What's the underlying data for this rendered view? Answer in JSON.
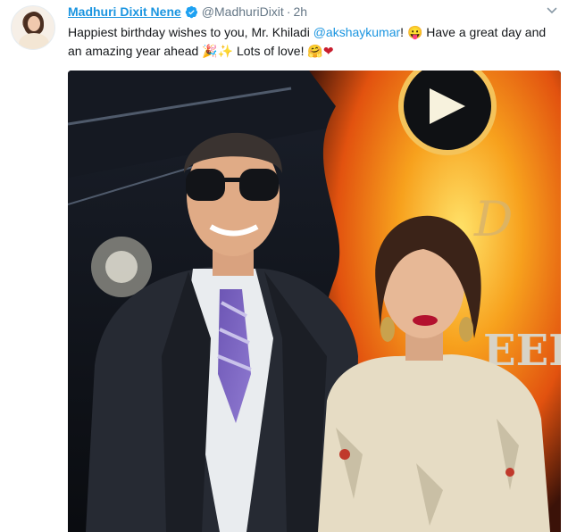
{
  "tweet": {
    "display_name": "Madhuri Dixit Nene",
    "handle": "@MadhuriDixit",
    "separator": "·",
    "time": "2h",
    "text_part1": "Happiest birthday wishes to you, Mr. Khiladi ",
    "mention": "@akshaykumar",
    "text_part2": "! ",
    "emoji_tongue": "😛",
    "text_part3": " Have a great day and an amazing year ahead ",
    "emoji_party": "🎉",
    "emoji_sparkles": "✨",
    "text_part4": " Lots of love! ",
    "emoji_hug": "🤗",
    "emoji_heart": "❤"
  },
  "colors": {
    "link": "#1b95e0",
    "muted": "#657786",
    "text": "#14171a"
  },
  "icons": {
    "verified": "verified-badge-icon",
    "more": "chevron-down-icon"
  }
}
